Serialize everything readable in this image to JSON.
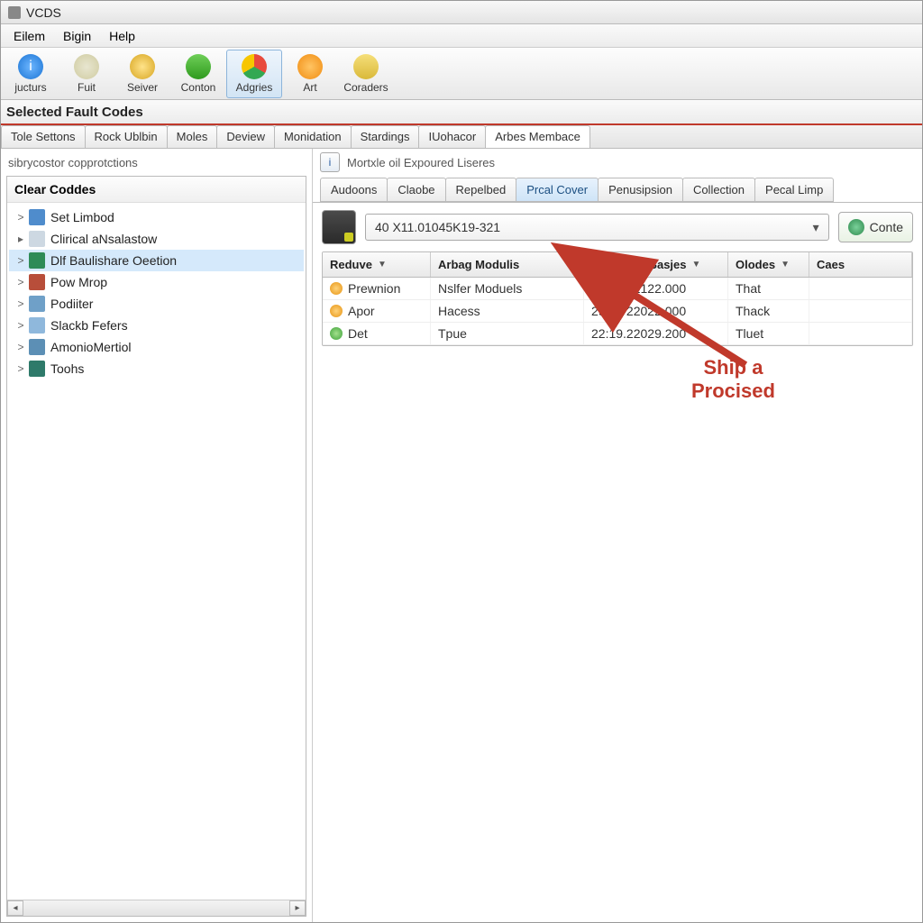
{
  "title": "VCDS",
  "menu": {
    "file": "Eilem",
    "begin": "Bigin",
    "help": "Help"
  },
  "toolbar": [
    {
      "label": "jucturs"
    },
    {
      "label": "Fuit"
    },
    {
      "label": "Seiver"
    },
    {
      "label": "Conton"
    },
    {
      "label": "Adgries"
    },
    {
      "label": "Art"
    },
    {
      "label": "Coraders"
    }
  ],
  "section_header": "Selected Fault Codes",
  "main_tabs": [
    "Tole Settons",
    "Rock Ublbin",
    "Moles",
    "Deview",
    "Monidation",
    "Stardings",
    "IUohacor",
    "Arbes Membace"
  ],
  "main_tabs_active_index": 7,
  "left": {
    "breadcrumb": "sibrycostor copprotctions",
    "tree_header": "Clear Coddes",
    "items": [
      "Set Limbod",
      "Clirical aNsalastow",
      "Dlf Baulishare Oeetion",
      "Pow Mrop",
      "Podiiter",
      "Slackb Fefers",
      "AmonioMertiol",
      "Toohs"
    ],
    "selected_index": 2
  },
  "right": {
    "panel_label": "Mortxle oil Expoured Liseres",
    "subtabs": [
      "Audoons",
      "Claobe",
      "Repelbed",
      "Prcal Cover",
      "Penusipsion",
      "Collection",
      "Pecal Limp"
    ],
    "subtabs_active_index": 3,
    "combo_value": "40 X11.01045K19-321",
    "context_btn": "Conte",
    "columns": [
      "Reduve",
      "Arbag Modulis",
      "UAF Seell Sasjes",
      "Olodes",
      "Caes"
    ],
    "rows": [
      {
        "status": "orange",
        "c0": "Prewnion",
        "c1": "Nslfer Moduels",
        "c2": "65:01.22122.000",
        "c3": "That",
        "c4": ""
      },
      {
        "status": "orange",
        "c0": "Apor",
        "c1": "Hacess",
        "c2": "29.01 22022.000",
        "c3": "Thack",
        "c4": ""
      },
      {
        "status": "green",
        "c0": "Det",
        "c1": "Tpue",
        "c2": "22:19.22029.200",
        "c3": "Tluet",
        "c4": ""
      }
    ]
  },
  "annotation": {
    "line1": "Ship a",
    "line2": "Procised"
  }
}
